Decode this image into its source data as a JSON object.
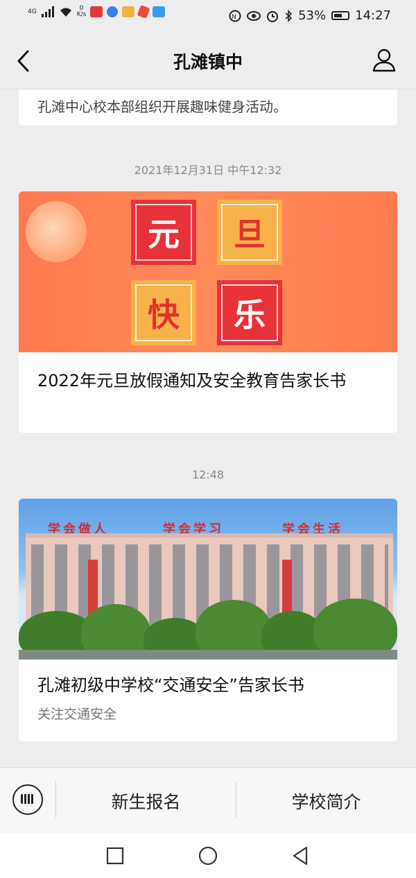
{
  "status_bar": {
    "network_type": "4G",
    "net_speed_value": "0",
    "net_speed_unit": "K/s",
    "battery": "53%",
    "time": "14:27",
    "icons": [
      "signal-icon",
      "wifi-icon",
      "toutiao-app-icon",
      "baidu-app-icon",
      "app-icon",
      "app-icon",
      "app-icon",
      "nfc-icon",
      "eye-icon",
      "alarm-icon",
      "bluetooth-icon",
      "battery-icon"
    ]
  },
  "navbar": {
    "title": "孔滩镇中",
    "left_icon": "back-arrow-icon",
    "right_icon": "user-profile-icon"
  },
  "feed": {
    "prev_card_text": "孔滩中心校本部组织开展趣味健身活动。",
    "items": [
      {
        "timestamp": "2021年12月31日 中午12:32",
        "banner_chars": [
          "元",
          "旦",
          "快",
          "乐"
        ],
        "title": "2022年元旦放假通知及安全教育告家长书"
      },
      {
        "timestamp": "12:48",
        "banner_slogans": [
          "学会做人",
          "学会学习",
          "学会生活"
        ],
        "title": "孔滩初级中学校“交通安全”告家长书",
        "subtitle": "关注交通安全"
      }
    ]
  },
  "bottom_menu": {
    "keyboard_icon": "keyboard-icon",
    "items": [
      {
        "label": "新生报名"
      },
      {
        "label": "学校简介"
      }
    ]
  },
  "system_nav": {
    "buttons": [
      "recent-apps-icon",
      "home-icon",
      "back-triangle-icon"
    ]
  },
  "colors": {
    "background": "#ededed",
    "banner_orange": "#ff7a4e",
    "tile_red": "#e8323a",
    "tile_gold": "#f7b24a"
  }
}
